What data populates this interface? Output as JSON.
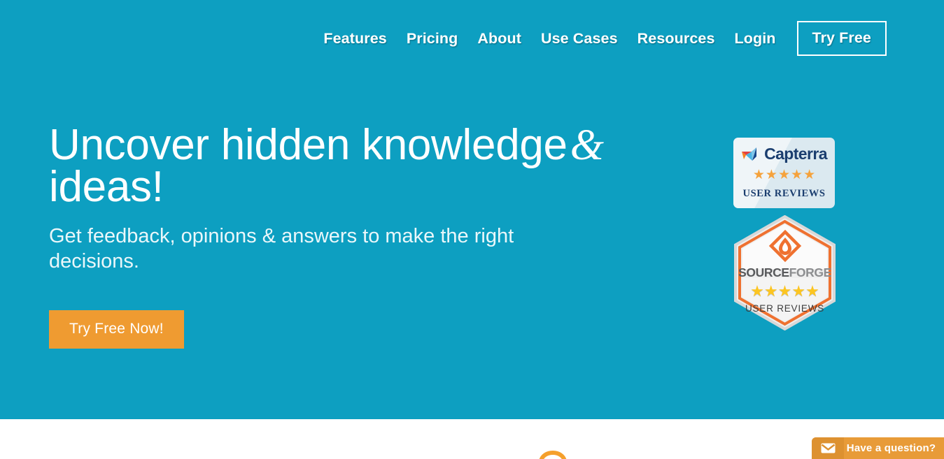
{
  "theme": {
    "hero_bg": "#0d9fc1",
    "accent_orange": "#ef9b31",
    "text_white": "#ffffff",
    "subheading": "#eaf7fa",
    "capterra_navy": "#1b3e6f",
    "capterra_card": "#dbe9f0",
    "capterra_star": "#f5a23c",
    "sourceforge_orange": "#ef7130",
    "sourceforge_star": "#fcc521",
    "sourceforge_gray": "#58595b",
    "chat_orange": "#e89b38",
    "chat_icon_orange": "#dd9130"
  },
  "nav": {
    "items": [
      {
        "label": "Features",
        "cta": false
      },
      {
        "label": "Pricing",
        "cta": false
      },
      {
        "label": "About",
        "cta": false
      },
      {
        "label": "Use Cases",
        "cta": false
      },
      {
        "label": "Resources",
        "cta": false
      },
      {
        "label": "Login",
        "cta": false
      },
      {
        "label": "Try Free",
        "cta": true
      }
    ]
  },
  "hero": {
    "title_line1": "Uncover hidden knowledge",
    "title_ampersand": "&",
    "title_line2": "ideas!",
    "subheading": "Get feedback, opinions & answers to make the right decisions.",
    "cta_label": "Try Free Now!"
  },
  "badges": {
    "capterra": {
      "logo_icon": "capterra-paper-plane-icon",
      "brand": "Capterra",
      "stars": 5,
      "star_glyph": "★",
      "caption": "USER REVIEWS"
    },
    "sourceforge": {
      "logo_icon": "sourceforge-flame-diamond-icon",
      "brand_part1": "SOURCE",
      "brand_part2": "FORGE",
      "stars": 5,
      "star_glyph": "★",
      "caption": "USER REVIEWS"
    }
  },
  "chat_widget": {
    "icon": "envelope-icon",
    "label": "Have a question?"
  }
}
